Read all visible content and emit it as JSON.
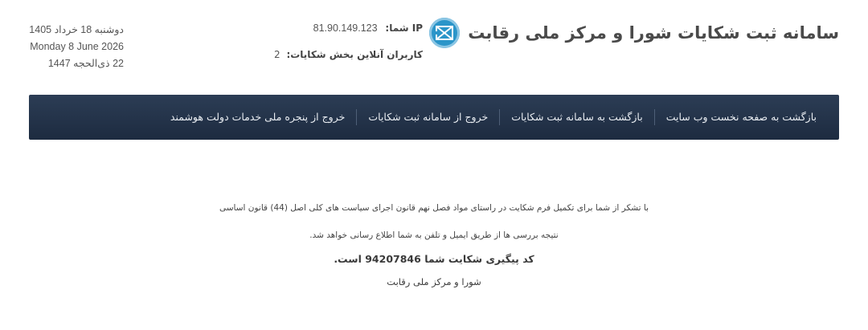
{
  "header": {
    "site_title": "سامانه ثبت شکایات شورا و مرکز ملی رقابت",
    "logo_icon": "envelope-logo-icon",
    "ip_label": "IP شما:",
    "ip_value": "81.90.149.123",
    "online_label": "کاربران آنلاین بخش شکایات:",
    "online_value": "2",
    "date_persian": "دوشنبه 18 خرداد 1405",
    "date_gregorian": "Monday 8 June 2026",
    "date_hijri": "22 ذی‌الحجه 1447"
  },
  "nav": {
    "items": [
      {
        "label": "بازگشت به صفحه نخست وب سایت"
      },
      {
        "label": "بازگشت به سامانه ثبت شکایات"
      },
      {
        "label": "خروج از سامانه ثبت شکایات"
      },
      {
        "label": "خروج از پنجره ملی خدمات دولت هوشمند"
      }
    ]
  },
  "content": {
    "thanks_line": "با تشکر از شما برای تکمیل فرم شکایت در راستای مواد فصل نهم قانون اجرای سیاست های کلی اصل (44) قانون اساسی",
    "result_line": "نتیجه بررسی ها از طریق ایمیل و تلفن به شما اطلاع رسانی خواهد شد.",
    "tracking_prefix": "کد پیگیری شکایت شما",
    "tracking_code": "94207846",
    "tracking_suffix": "است.",
    "signature": "شورا و مرکز ملی رقابت"
  },
  "colors": {
    "navbar": "#233349",
    "logo": "#2b95c9"
  }
}
